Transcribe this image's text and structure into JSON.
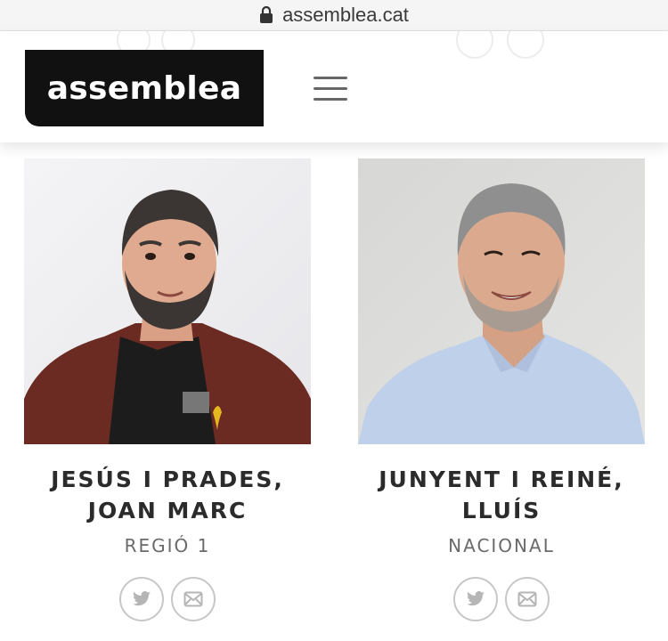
{
  "browser": {
    "url": "assemblea.cat"
  },
  "header": {
    "logo_text": "assemblea",
    "menu_icon": "hamburger-icon"
  },
  "members": [
    {
      "name_line1": "JESÚS I PRADES,",
      "name_line2": "JOAN MARC",
      "role": "REGIÓ 1",
      "icons": [
        "twitter-icon",
        "mail-icon"
      ]
    },
    {
      "name_line1": "JUNYENT I REINÉ,",
      "name_line2": "LLUÍS",
      "role": "NACIONAL",
      "icons": [
        "twitter-icon",
        "mail-icon"
      ]
    }
  ],
  "colors": {
    "logo_bg": "#111111",
    "text": "#2b2b2b",
    "muted": "#6a6a6a",
    "icon_border": "#c7c7c7"
  }
}
